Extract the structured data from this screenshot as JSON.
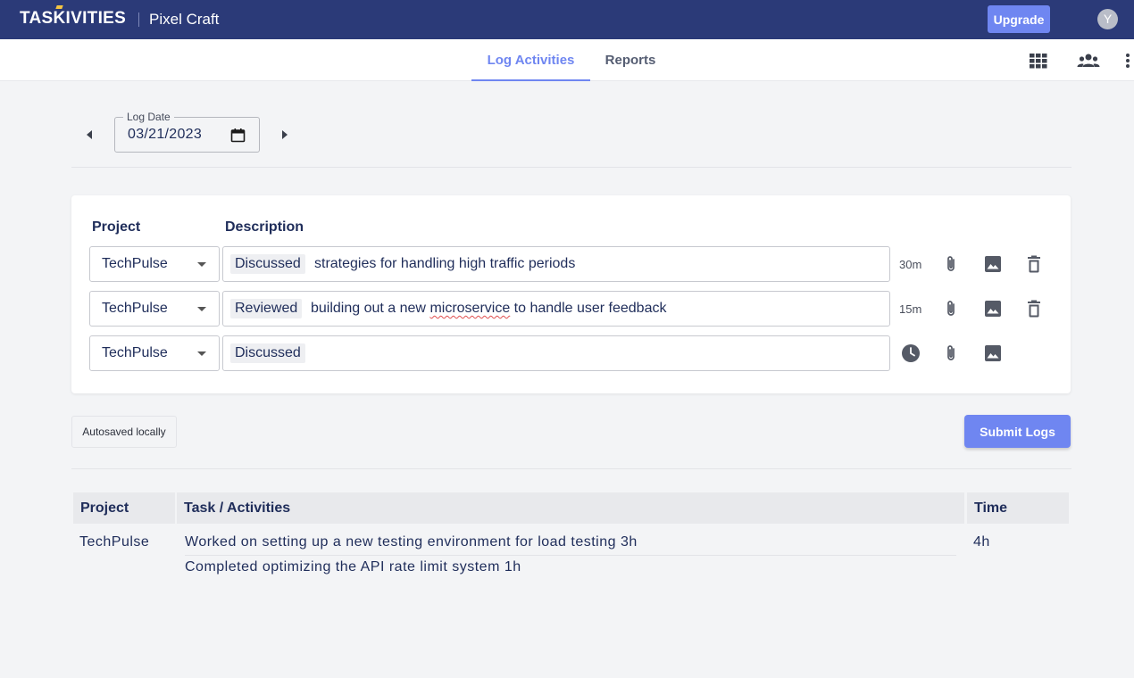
{
  "app": {
    "logo_text": "TASKIVITIES",
    "workspace_name": "Pixel Craft",
    "upgrade_label": "Upgrade",
    "avatar_initial": "Y"
  },
  "nav": {
    "tabs": [
      {
        "label": "Log Activities",
        "active": true
      },
      {
        "label": "Reports",
        "active": false
      }
    ],
    "icons": [
      "grid-icon",
      "team-icon",
      "more-vert-icon"
    ]
  },
  "log_date": {
    "label": "Log Date",
    "value": "03/21/2023"
  },
  "entry_form": {
    "headers": {
      "project": "Project",
      "description": "Description"
    },
    "rows": [
      {
        "project": "TechPulse",
        "tag": "Discussed",
        "text_before": "strategies for handling high traffic periods",
        "misspelled": "",
        "text_after": "",
        "duration": "30m",
        "has_delete": true
      },
      {
        "project": "TechPulse",
        "tag": "Reviewed",
        "text_before": "building out a new ",
        "misspelled": "microservice",
        "text_after": " to handle user feedback",
        "duration": "15m",
        "has_delete": true
      },
      {
        "project": "TechPulse",
        "tag": "Discussed",
        "text_before": "",
        "misspelled": "",
        "text_after": "",
        "duration": "",
        "has_delete": false
      }
    ]
  },
  "autosave_label": "Autosaved locally",
  "submit_label": "Submit Logs",
  "summary_table": {
    "headers": [
      "Project",
      "Task / Activities",
      "Time"
    ],
    "rows": [
      {
        "project": "TechPulse",
        "activities": [
          "Worked on setting up a new testing environment for load testing 3h",
          "Completed optimizing the API rate limit system 1h"
        ],
        "time": "4h"
      }
    ]
  },
  "colors": {
    "topbar": "#2b3a78",
    "accent": "#6f86f1",
    "text": "#1f2d5a",
    "background": "#f3f4f6"
  }
}
